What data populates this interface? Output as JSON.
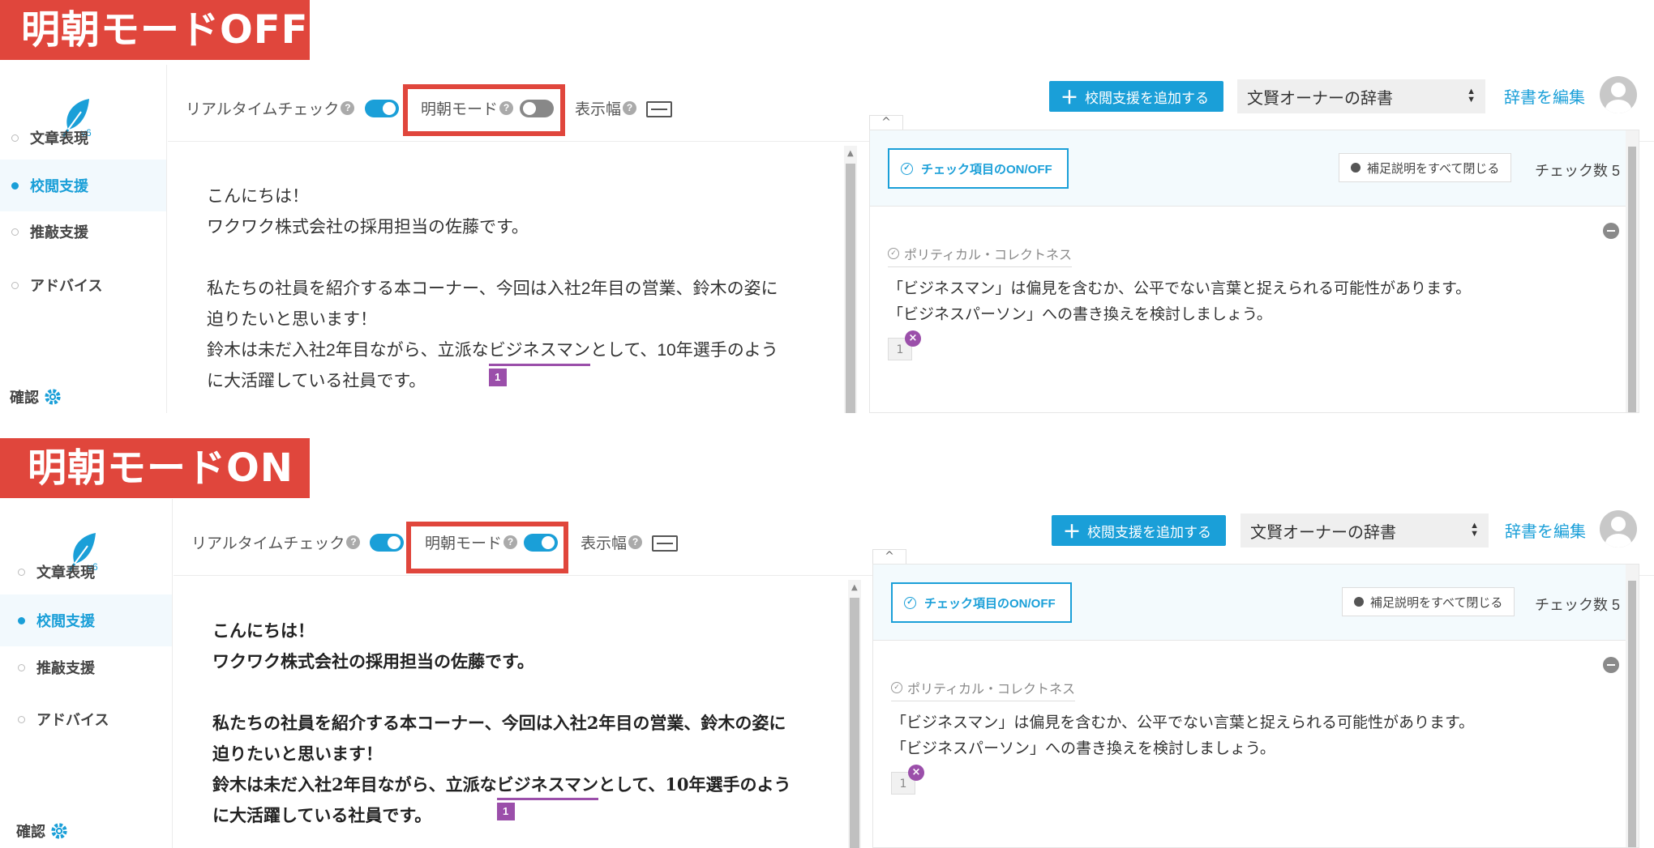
{
  "banners": {
    "off": "明朝モードOFF",
    "on": "明朝モードON"
  },
  "sidebar": {
    "version": "v6",
    "items": [
      {
        "label": "文章表現"
      },
      {
        "label": "校閲支援"
      },
      {
        "label": "推敲支援"
      },
      {
        "label": "アドバイス"
      }
    ],
    "active_item": "校閲支援",
    "confirm_label": "確認"
  },
  "toolbar": {
    "realtime_label": "リアルタイムチェック",
    "realtime_on": true,
    "mincho_label": "明朝モード",
    "width_label": "表示幅",
    "help_glyph": "?",
    "add_button": "校閲支援を追加する",
    "add_plus": "＋",
    "dict_value": "文賢オーナーの辞書",
    "edit_link": "辞書を編集"
  },
  "panels": [
    {
      "mincho_on": false
    },
    {
      "mincho_on": true
    }
  ],
  "editor": {
    "lines": [
      "こんにちは！",
      "ワクワク株式会社の採用担当の佐藤です。",
      "",
      "私たちの社員を紹介する本コーナー、今回は入社2年目の営業、鈴木の姿に",
      "迫りたいと思います！"
    ],
    "flag_line_before": "鈴木は未だ入社2年目ながら、立派な",
    "flag_word": "ビジネスマン",
    "flag_line_after": "として、10年選手のよう",
    "last_line": "に大活躍している社員です。",
    "flag_number": "1"
  },
  "results": {
    "onoff_button": "チェック項目のON/OFF",
    "close_all_button": "補足説明をすべて閉じる",
    "check_count": "チェック数 5",
    "category": "ポリティカル・コレクトネス",
    "message_line1": "「ビジネスマン」は偏見を含むか、公平でない言葉と捉えられる可能性があります。",
    "message_line2": "「ビジネスパーソン」への書き換えを検討しましょう。",
    "occurrence_number": "1",
    "occurrence_remove": "×",
    "tab_glyph": "^"
  },
  "colors": {
    "accent": "#1a9fd8",
    "banner": "#e0463c",
    "flag": "#9b4faa"
  }
}
